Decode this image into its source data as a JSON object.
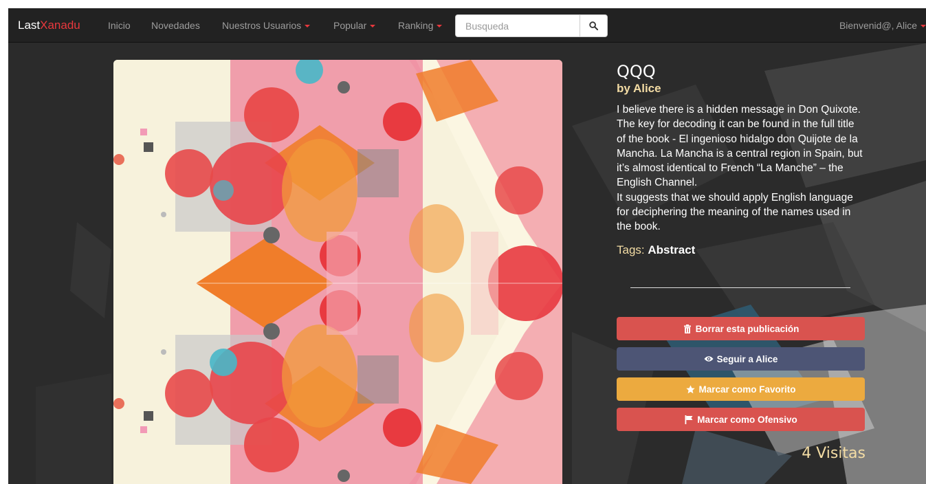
{
  "navbar": {
    "brand_first": "Last",
    "brand_second": "Xanadu",
    "items": [
      {
        "label": "Inicio"
      },
      {
        "label": "Novedades"
      },
      {
        "label": "Nuestros Usuarios"
      },
      {
        "label": "Popular"
      },
      {
        "label": "Ranking"
      }
    ],
    "search_placeholder": "Busqueda",
    "user_greeting": "Bienvenid@, Alice"
  },
  "post": {
    "title": "QQQ",
    "author_prefix": "by",
    "author": "Alice",
    "body_lines": [
      "I believe there is a hidden message in Don Quixote. The key for decoding it can be found in the full title of the book - El ingenioso hidalgo don Quijote de la Mancha. La Mancha is a central region in Spain, but it’s almost identical to French “La Manche” – the English Channel.",
      "It suggests that we should apply English language for deciphering the meaning of the names used in the book."
    ],
    "tags_label": "Tags:",
    "tag": "Abstract",
    "visits": "4 Visitas"
  },
  "actions": {
    "delete": "Borrar esta publicación",
    "follow": "Seguir a Alice",
    "favorite": "Marcar como Favorito",
    "flag": "Marcar como Ofensivo"
  },
  "colors": {
    "accent": "#e8383d",
    "delete_button": "#d9534f",
    "follow_button": "#4d5575",
    "favorite_button": "#ecaa3f",
    "flag_button": "#d9534f",
    "author_color": "#f3dca4"
  },
  "icons": {
    "search": "search-icon",
    "delete": "trash-icon",
    "follow": "eye-icon",
    "favorite": "star-icon",
    "flag": "flag-icon"
  }
}
